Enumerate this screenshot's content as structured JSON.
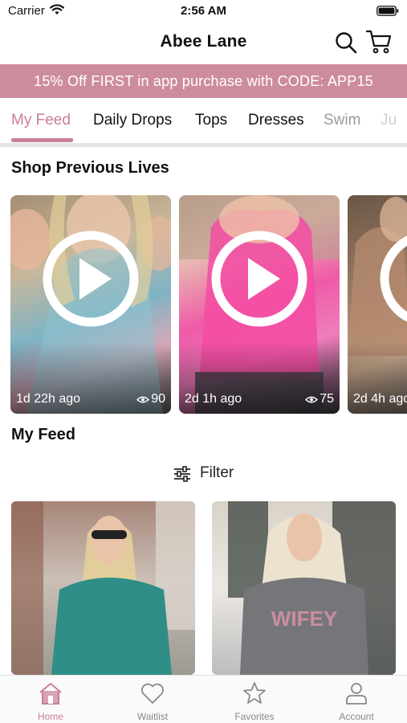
{
  "status_bar": {
    "carrier": "Carrier",
    "time": "2:56 AM"
  },
  "header": {
    "title": "Abee Lane"
  },
  "promo": {
    "text": "15% Off FIRST in app purchase with CODE: APP15"
  },
  "tabs": [
    {
      "label": "My Feed",
      "active": true
    },
    {
      "label": "Daily Drops"
    },
    {
      "label": "Tops"
    },
    {
      "label": "Dresses"
    },
    {
      "label": "Swim"
    },
    {
      "label": "Ju"
    }
  ],
  "lives": {
    "title": "Shop Previous Lives",
    "items": [
      {
        "ago": "1d 22h ago",
        "views": "90"
      },
      {
        "ago": "2d 1h ago",
        "views": "75"
      },
      {
        "ago": "2d 4h ago",
        "views": ""
      }
    ]
  },
  "feed": {
    "title": "My Feed",
    "filter_label": "Filter",
    "products": [
      {
        "image": "teal-long-sleeve-top-photo"
      },
      {
        "image": "wifey-graphic-tee-photo"
      }
    ]
  },
  "bottom_nav": [
    {
      "label": "Home",
      "icon": "home-icon",
      "active": true
    },
    {
      "label": "Waitlist",
      "icon": "heart-icon"
    },
    {
      "label": "Favorites",
      "icon": "star-icon"
    },
    {
      "label": "Account",
      "icon": "person-icon"
    }
  ],
  "colors": {
    "accent": "#c77f93",
    "promo_bg": "#cd8c9c"
  }
}
